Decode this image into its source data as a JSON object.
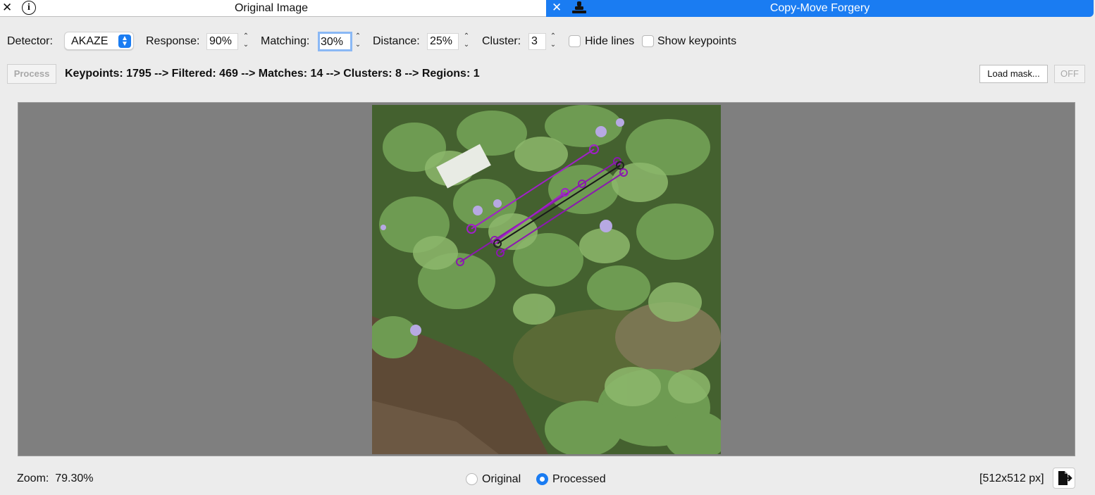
{
  "tabs": {
    "left": {
      "title": "Original Image",
      "close_icon": "close-icon",
      "info_icon": "info-icon"
    },
    "right": {
      "title": "Copy-Move Forgery",
      "close_icon": "close-icon",
      "stamp_icon": "stamp-icon",
      "color": "#1a7cf2"
    }
  },
  "toolbar": {
    "detector_label": "Detector:",
    "detector_value": "AKAZE",
    "response_label": "Response:",
    "response_value": "90%",
    "matching_label": "Matching:",
    "matching_value": "30%",
    "distance_label": "Distance:",
    "distance_value": "25%",
    "cluster_label": "Cluster:",
    "cluster_value": "3",
    "hide_lines_label": "Hide lines",
    "hide_lines_checked": false,
    "show_keypoints_label": "Show keypoints",
    "show_keypoints_checked": false
  },
  "actions": {
    "process_label": "Process",
    "pipeline_text": "Keypoints: 1795 --> Filtered: 469 --> Matches: 14 --> Clusters: 8 --> Regions: 1",
    "load_mask_label": "Load mask...",
    "off_label": "OFF"
  },
  "footer": {
    "zoom_label": "Zoom:",
    "zoom_value": "79.30%",
    "original_label": "Original",
    "processed_label": "Processed",
    "selected_view": "Processed",
    "dimensions": "[512x512 px]"
  }
}
